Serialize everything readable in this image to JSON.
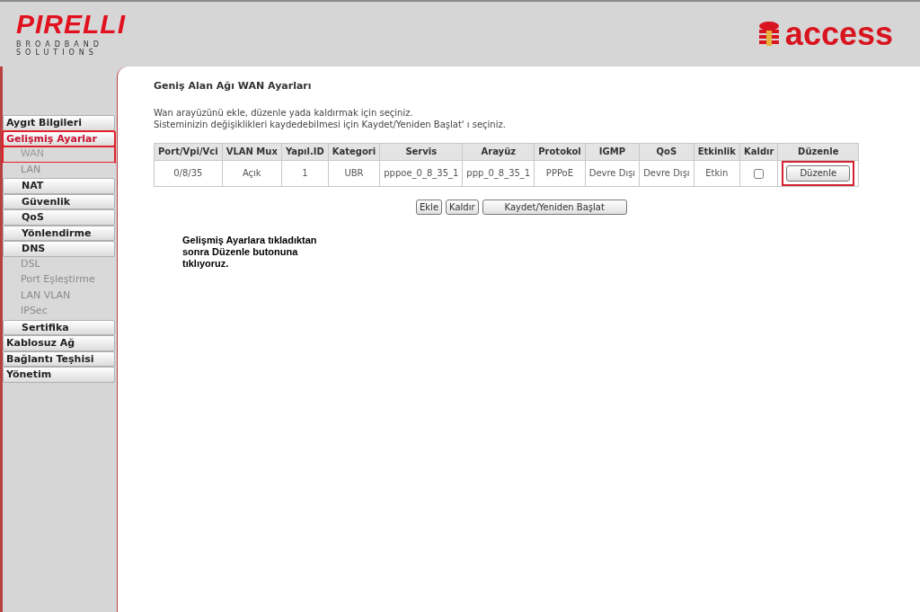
{
  "header": {
    "brand": "PIRELLI",
    "brand_sub": [
      "BROADBAND",
      "SOLUTIONS"
    ],
    "partner": "access"
  },
  "sidebar": {
    "items": [
      {
        "label": "Aygıt Bilgileri",
        "kind": "top",
        "selected": false,
        "highlighted": false
      },
      {
        "label": "Gelişmiş Ayarlar",
        "kind": "top",
        "selected": true,
        "highlighted": true
      },
      {
        "label": "WAN",
        "kind": "link",
        "selected": true,
        "highlighted": true
      },
      {
        "label": "LAN",
        "kind": "link",
        "selected": false,
        "highlighted": false
      },
      {
        "label": "NAT",
        "kind": "section",
        "selected": false,
        "highlighted": false
      },
      {
        "label": "Güvenlik",
        "kind": "section",
        "selected": false,
        "highlighted": false
      },
      {
        "label": "QoS",
        "kind": "section",
        "selected": false,
        "highlighted": false
      },
      {
        "label": "Yönlendirme",
        "kind": "section",
        "selected": false,
        "highlighted": false
      },
      {
        "label": "DNS",
        "kind": "section",
        "selected": false,
        "highlighted": false
      },
      {
        "label": "DSL",
        "kind": "link",
        "selected": false,
        "highlighted": false
      },
      {
        "label": "Port Eşleştirme",
        "kind": "link",
        "selected": false,
        "highlighted": false
      },
      {
        "label": "LAN VLAN",
        "kind": "link",
        "selected": false,
        "highlighted": false
      },
      {
        "label": "IPSec",
        "kind": "link",
        "selected": false,
        "highlighted": false
      },
      {
        "label": "Sertifika",
        "kind": "section",
        "selected": false,
        "highlighted": false
      },
      {
        "label": "Kablosuz Ağ",
        "kind": "top",
        "selected": false,
        "highlighted": false
      },
      {
        "label": "Bağlantı Teşhisi",
        "kind": "top",
        "selected": false,
        "highlighted": false
      },
      {
        "label": "Yönetim",
        "kind": "top",
        "selected": false,
        "highlighted": false
      }
    ]
  },
  "main": {
    "title": "Geniş Alan Ağı WAN Ayarları",
    "instructions": [
      "Wan arayüzünü ekle, düzenle yada kaldırmak için seçiniz.",
      "Sisteminizin değişiklikleri kaydedebilmesi için Kaydet/Yeniden Başlat' ı seçiniz."
    ],
    "table": {
      "columns": [
        "Port/Vpi/Vci",
        "VLAN Mux",
        "Yapıl.ID",
        "Kategori",
        "Servis",
        "Arayüz",
        "Protokol",
        "IGMP",
        "QoS",
        "Etkinlik",
        "Kaldır",
        "Düzenle"
      ],
      "rows": [
        {
          "cells": [
            "0/8/35",
            "Açık",
            "1",
            "UBR",
            "pppoe_0_8_35_1",
            "ppp_0_8_35_1",
            "PPPoE",
            "Devre Dışı",
            "Devre Dışı",
            "Etkin"
          ],
          "remove_checked": false,
          "edit_button": "Düzenle",
          "edit_highlighted": true
        }
      ]
    },
    "buttons": [
      "Ekle",
      "Kaldır",
      "Kaydet/Yeniden Başlat"
    ],
    "note": "Gelişmiş Ayarlara tıkladıktan sonra Düzenle butonuna tıklıyoruz."
  }
}
